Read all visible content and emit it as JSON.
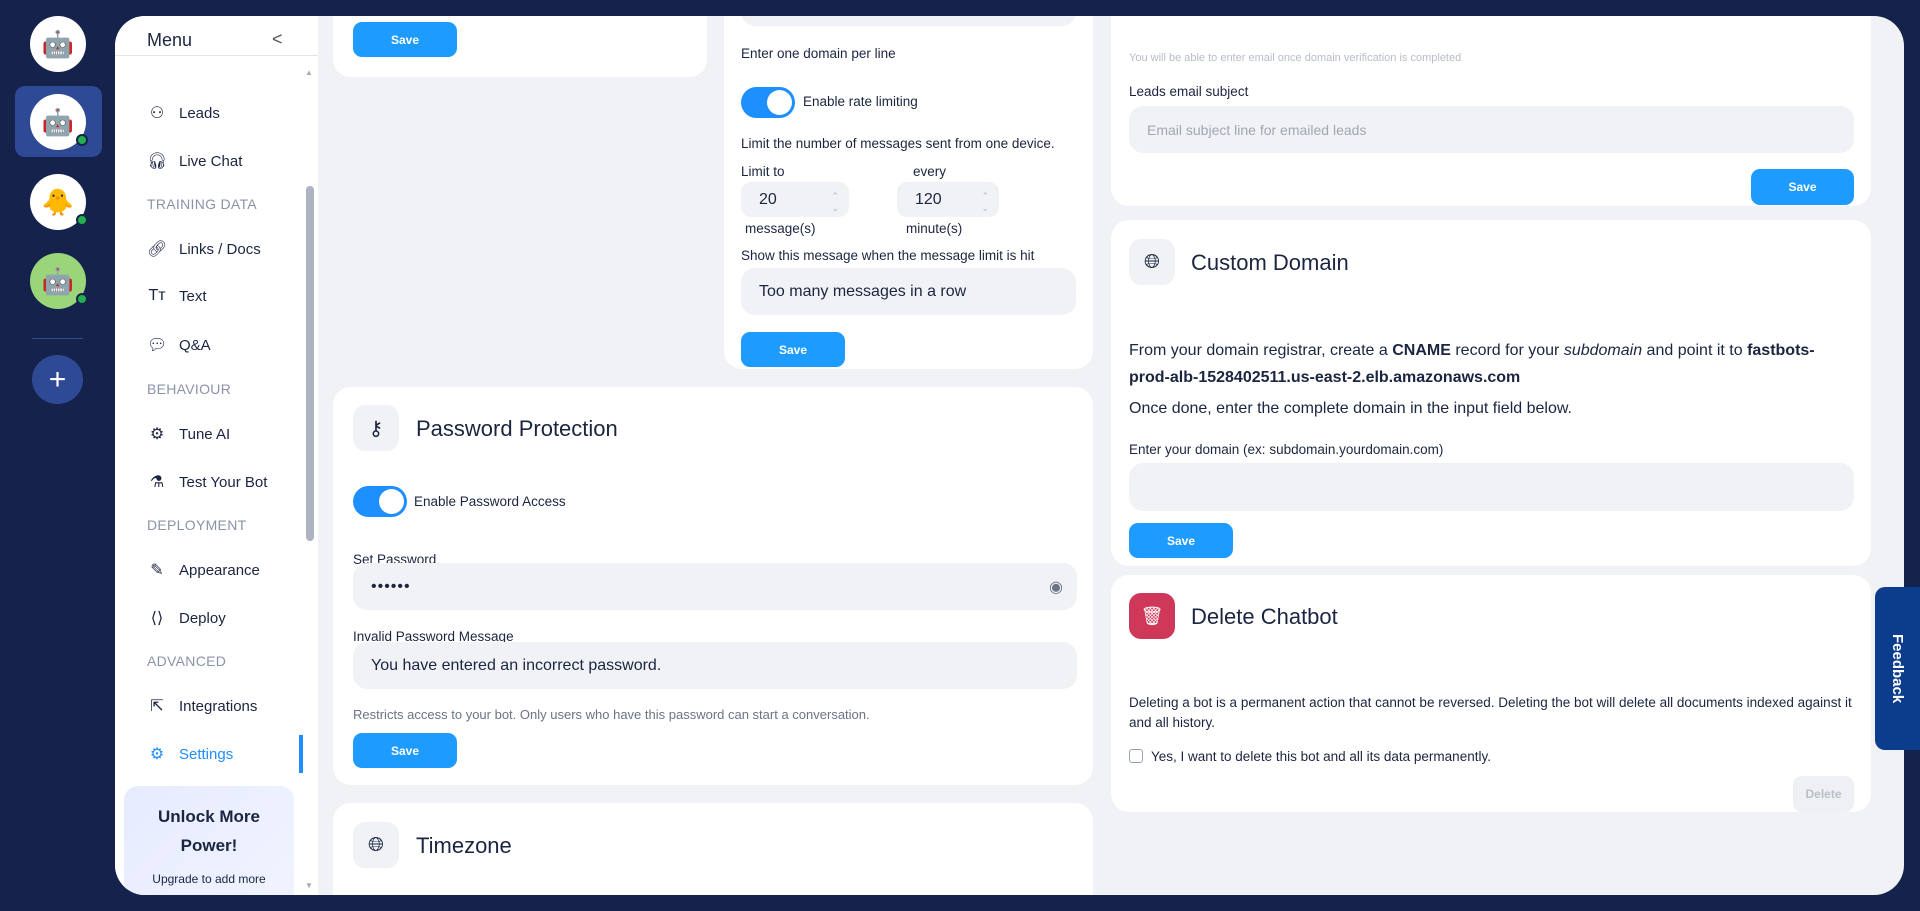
{
  "rail": {
    "bots": [
      "bot-logo",
      "bot-1",
      "bot-2",
      "bot-3"
    ],
    "add": "+"
  },
  "menu": {
    "title": "Menu",
    "collapse": "<",
    "items": [
      {
        "label": "Leads",
        "icon": "leads-icon"
      },
      {
        "label": "Live Chat",
        "icon": "headset-icon"
      }
    ],
    "training_label": "TRAINING DATA",
    "training": [
      {
        "label": "Links / Docs"
      },
      {
        "label": "Text"
      },
      {
        "label": "Q&A"
      }
    ],
    "behaviour_label": "BEHAVIOUR",
    "behaviour": [
      {
        "label": "Tune AI"
      },
      {
        "label": "Test Your Bot"
      }
    ],
    "deployment_label": "DEPLOYMENT",
    "deployment": [
      {
        "label": "Appearance"
      },
      {
        "label": "Deploy"
      }
    ],
    "advanced_label": "ADVANCED",
    "advanced": [
      {
        "label": "Integrations"
      },
      {
        "label": "Settings"
      }
    ],
    "promo": {
      "title": "Unlock More Power!",
      "text": "Upgrade to add more"
    }
  },
  "top_left": {
    "save": "Save"
  },
  "rate": {
    "domain_hint": "Enter one domain per line",
    "toggle_label": "Enable rate limiting",
    "desc": "Limit the number of messages sent from one device.",
    "limit_label": "Limit to",
    "every_label": "every",
    "limit_value": "20",
    "every_value": "120",
    "limit_unit": "message(s)",
    "every_unit": "minute(s)",
    "msg_label": "Show this message when the message limit is hit",
    "msg_value": "Too many messages in a row",
    "save": "Save"
  },
  "password": {
    "title": "Password Protection",
    "toggle_label": "Enable Password Access",
    "set_label": "Set Password",
    "set_value": "••••••",
    "invalid_label": "Invalid Password Message",
    "invalid_value": "You have entered an incorrect password.",
    "hint": "Restricts access to your bot. Only users who have this password can start a conversation.",
    "save": "Save"
  },
  "timezone": {
    "title": "Timezone"
  },
  "email": {
    "notice": "You will be able to enter email once domain verification is completed",
    "subject_label": "Leads email subject",
    "subject_placeholder": "Email subject line for emailed leads",
    "save": "Save"
  },
  "domain": {
    "title": "Custom Domain",
    "t1": "From your domain registrar, create a ",
    "t2": "CNAME",
    "t3": " record for your ",
    "t4": "subdomain",
    "t5": " and point it to ",
    "t6": "fastbots-prod-alb-1528402511.us-east-2.elb.amazonaws.com",
    "once": "Once done, enter the complete domain in the input field below.",
    "input_label": "Enter your domain (ex: subdomain.yourdomain.com)",
    "save": "Save"
  },
  "delete": {
    "title": "Delete Chatbot",
    "desc": "Deleting a bot is a permanent action that cannot be reversed. Deleting the bot will delete all documents indexed against it and all history.",
    "confirm": "Yes, I want to delete this bot and all its data permanently.",
    "button": "Delete",
    "color": "#d0385a"
  },
  "feedback": "Feedback"
}
